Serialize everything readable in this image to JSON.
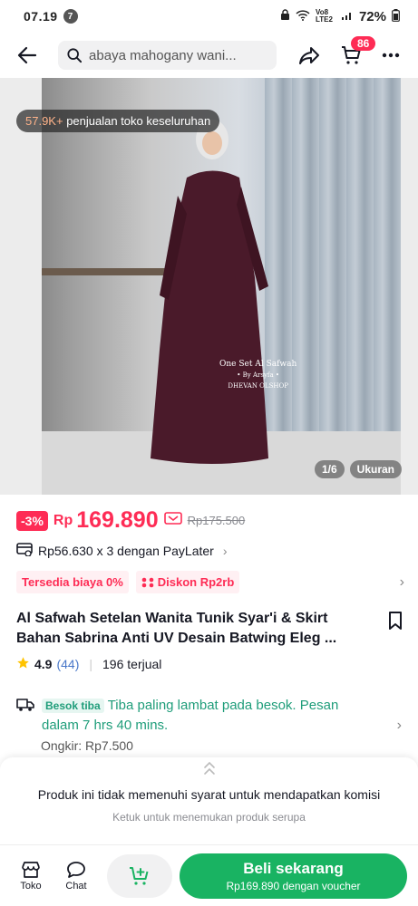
{
  "status_bar": {
    "time": "07.19",
    "notif_count": "7",
    "network": "Vo8 LTE2",
    "battery": "72%"
  },
  "header": {
    "search_value": "abaya mahogany wani...",
    "cart_count": "86"
  },
  "gallery": {
    "sales_count": "57.9K+",
    "sales_text": " penjualan toko keseluruhan",
    "image_index": "1/6",
    "size_label": "Ukuran",
    "watermark_line1": "One Set Al Safwah",
    "watermark_line2": "• By Arsyfa •",
    "watermark_line3": "DHEVAN OLSHOP"
  },
  "price": {
    "discount": "-3%",
    "currency": "Rp",
    "current": "169.890",
    "original": "Rp175.500"
  },
  "paylater": {
    "text": "Rp56.630 x 3 dengan PayLater"
  },
  "tags": [
    {
      "label": "Tersedia biaya 0%"
    },
    {
      "label": "Diskon Rp2rb"
    }
  ],
  "product": {
    "title": "Al Safwah Setelan Wanita Tunik Syar'i & Skirt Bahan Sabrina Anti UV Desain Batwing Eleg ...",
    "rating": "4.9",
    "review_count": "(44)",
    "sold": "196 terjual"
  },
  "shipping": {
    "badge": "Besok tiba",
    "text": "Tiba paling lambat pada besok. Pesan dalam 7 hrs 40 mins.",
    "ongkir": "Ongkir: Rp7.500"
  },
  "commission": {
    "main": "Produk ini tidak memenuhi syarat untuk mendapatkan komisi",
    "sub": "Ketuk untuk menemukan produk serupa"
  },
  "bottom": {
    "shop_label": "Toko",
    "chat_label": "Chat",
    "buy_label": "Beli sekarang",
    "buy_sub": "Rp169.890 dengan voucher"
  },
  "colors": {
    "accent": "#fe2c55",
    "buy": "#19b362",
    "shipping": "#1f9d7a"
  }
}
